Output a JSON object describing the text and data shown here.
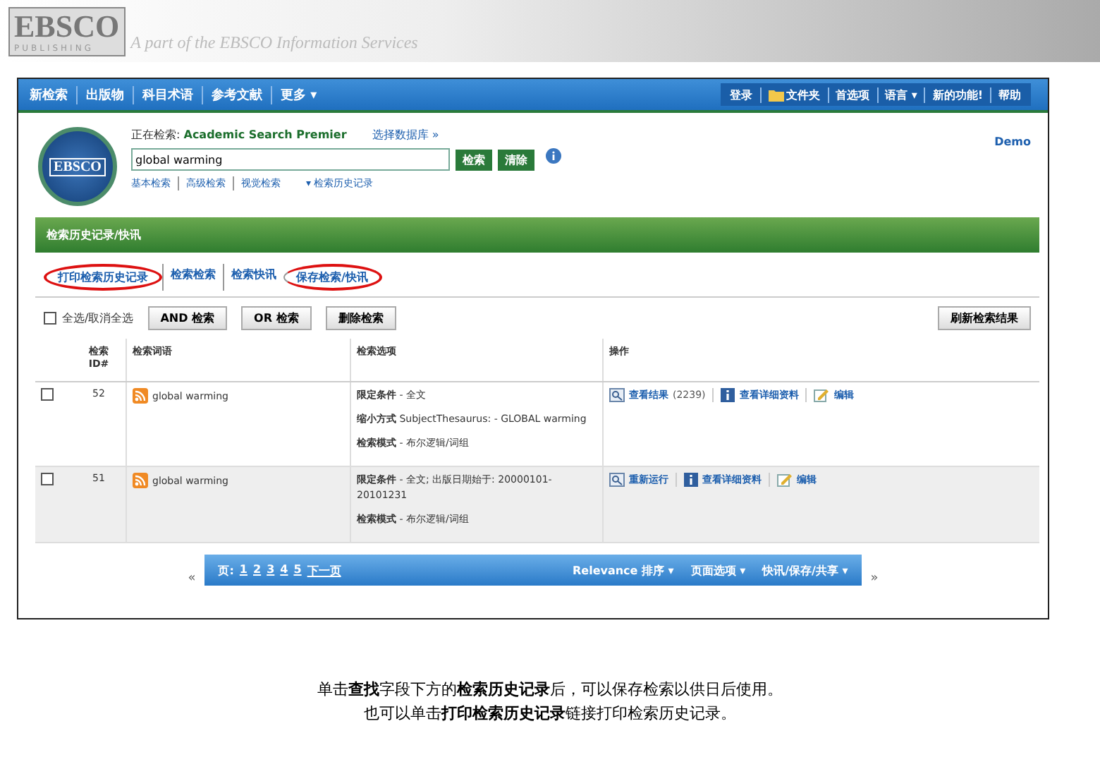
{
  "banner": {
    "logo": "EBSCO",
    "logo_sub": "PUBLISHING",
    "tagline": "A part of the EBSCO Information Services"
  },
  "nav": {
    "left": [
      {
        "label": "新检索"
      },
      {
        "label": "出版物"
      },
      {
        "label": "科目术语"
      },
      {
        "label": "参考文献"
      },
      {
        "label": "更多 ▾"
      }
    ],
    "right": [
      {
        "label": "登录",
        "kind": "text"
      },
      {
        "label": "文件夹",
        "kind": "folder"
      },
      {
        "label": "首选项",
        "kind": "text"
      },
      {
        "label": "语言 ▾",
        "kind": "text"
      },
      {
        "label": "新的功能!",
        "kind": "text"
      },
      {
        "label": "帮助",
        "kind": "text"
      }
    ]
  },
  "search": {
    "logo": "EBSCO",
    "db_label": "正在检索:",
    "db_name": "Academic Search Premier",
    "choose_db": "选择数据库 »",
    "value": "global warming",
    "buttons": [
      "检索",
      "清除"
    ],
    "links": [
      {
        "label": "基本检索"
      },
      {
        "label": "高级检索"
      },
      {
        "label": "视觉检索"
      }
    ],
    "history_link": "▾ 检索历史记录",
    "user": "Demo"
  },
  "history": {
    "title": "检索历史记录/快讯",
    "links": [
      {
        "label": "打印检索历史记录",
        "circled": true
      },
      {
        "label": "检索检索",
        "circled": false
      },
      {
        "label": "检索快讯",
        "circled": false
      },
      {
        "label": "保存检索/快讯",
        "circled": true
      }
    ],
    "select_all": {
      "label": "全选/取消全选",
      "checked": false
    },
    "buttons": [
      "AND 检索",
      "OR 检索",
      "删除检索"
    ],
    "refresh": "刷新检索结果",
    "columns": [
      "检索 ID#",
      "检索词语",
      "检索选项",
      "操作"
    ],
    "rows": [
      {
        "checked": false,
        "id": "52",
        "terms": "global warming",
        "options": [
          {
            "label": "限定条件",
            "value": "- 全文"
          },
          {
            "label": "缩小方式",
            "value": "SubjectThesaurus: - GLOBAL warming"
          },
          {
            "label": "检索模式",
            "value": "- 布尔逻辑/词组"
          }
        ],
        "actions": [
          {
            "kind": "view",
            "label": "查看结果",
            "count": "(2239)"
          },
          {
            "kind": "info",
            "label": "查看详细资料"
          },
          {
            "kind": "edit",
            "label": "编辑"
          }
        ]
      },
      {
        "checked": false,
        "id": "51",
        "terms": "global warming",
        "options": [
          {
            "label": "限定条件",
            "value": "- 全文; 出版日期始于: 20000101-20101231"
          },
          {
            "label": "检索模式",
            "value": "- 布尔逻辑/词组"
          }
        ],
        "actions": [
          {
            "kind": "view",
            "label": "重新运行"
          },
          {
            "kind": "info",
            "label": "查看详细资料"
          },
          {
            "kind": "edit",
            "label": "编辑"
          }
        ]
      }
    ]
  },
  "results_bar": {
    "page_label": "页:",
    "pages": [
      "1",
      "2",
      "3",
      "4",
      "5"
    ],
    "next": "下一页",
    "menus": [
      "Relevance 排序 ▾",
      "页面选项 ▾",
      "快讯/保存/共享 ▾"
    ],
    "prev_arrow": "«",
    "next_arrow": "»"
  },
  "caption": [
    "单击**查找**字段下方的**检索历史记录**后，可以保存检索以供日后使用。",
    "也可以单击**打印检索历史记录**链接打印检索历史记录。"
  ]
}
